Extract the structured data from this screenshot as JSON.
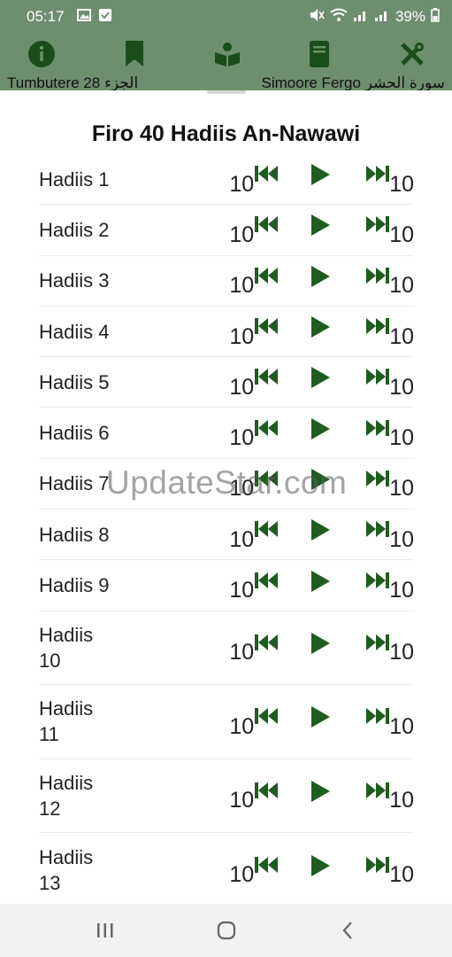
{
  "status_bar": {
    "time": "05:17",
    "battery": "39%"
  },
  "top_nav": {
    "icons": [
      "info-icon",
      "bookmark-icon",
      "reader-icon",
      "book-icon",
      "tools-icon"
    ],
    "label_left": "Tumbutere 28 الجزء",
    "label_right": "Simoore Fergo سورة الحشر"
  },
  "sheet": {
    "title": "Firo 40 Hadiis An-Nawawi",
    "rows": [
      {
        "name": "Hadiis 1",
        "back": "10",
        "fwd": "10"
      },
      {
        "name": "Hadiis 2",
        "back": "10",
        "fwd": "10"
      },
      {
        "name": "Hadiis 3",
        "back": "10",
        "fwd": "10"
      },
      {
        "name": "Hadiis 4",
        "back": "10",
        "fwd": "10"
      },
      {
        "name": "Hadiis 5",
        "back": "10",
        "fwd": "10"
      },
      {
        "name": "Hadiis 6",
        "back": "10",
        "fwd": "10"
      },
      {
        "name": "Hadiis 7",
        "back": "10",
        "fwd": "10"
      },
      {
        "name": "Hadiis 8",
        "back": "10",
        "fwd": "10"
      },
      {
        "name": "Hadiis 9",
        "back": "10",
        "fwd": "10"
      },
      {
        "name": "Hadiis 10",
        "back": "10",
        "fwd": "10"
      },
      {
        "name": "Hadiis 11",
        "back": "10",
        "fwd": "10"
      },
      {
        "name": "Hadiis 12",
        "back": "10",
        "fwd": "10"
      },
      {
        "name": "Hadiis 13",
        "back": "10",
        "fwd": "10"
      }
    ]
  },
  "watermark": "UpdateStar.com",
  "colors": {
    "accent": "#1f5c1f",
    "nav_bg": "#6e8f6e",
    "system_nav_bg": "#f2f2f2"
  }
}
